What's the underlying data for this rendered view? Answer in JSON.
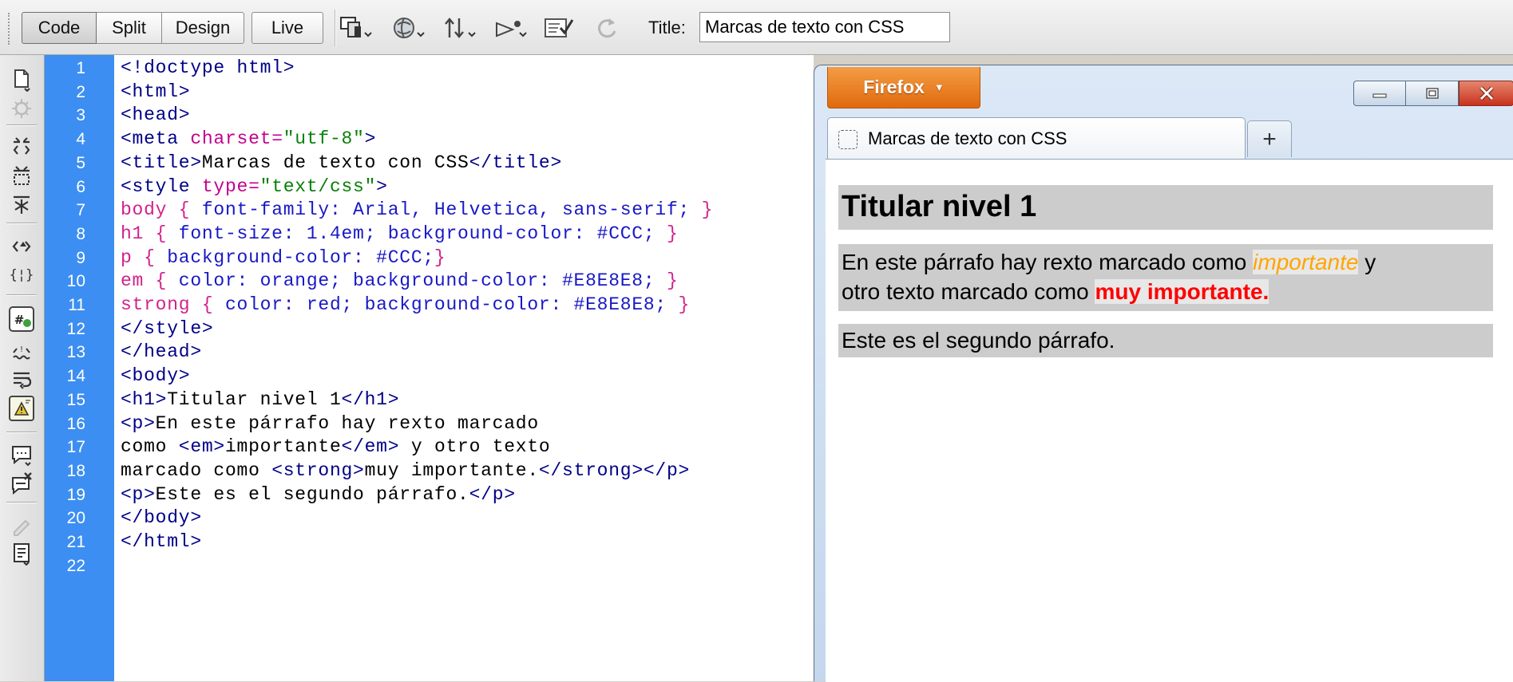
{
  "toolbar": {
    "views": [
      "Code",
      "Split",
      "Design",
      "Live"
    ],
    "active_view": "Code",
    "title_label": "Title:",
    "title_value": "Marcas de texto con CSS",
    "tools": [
      "multiscreen-icon",
      "preview-globe-icon",
      "file-transfer-icon",
      "visual-aids-icon",
      "validate-icon",
      "refresh-icon"
    ]
  },
  "rail": {
    "icons": [
      "open-documents-icon",
      "show-code-navigator-icon",
      "collapse-full-tag-icon",
      "collapse-selection-icon",
      "expand-all-icon",
      "select-parent-tag-icon",
      "balance-braces-icon",
      "line-numbers-icon",
      "highlight-invalid-code-icon",
      "word-wrap-icon",
      "syntax-error-alerts-icon",
      "apply-comment-icon",
      "remove-comment-icon",
      "wrap-tag-icon",
      "recent-snippets-icon"
    ]
  },
  "editor": {
    "line_numbers": [
      "1",
      "2",
      "3",
      "4",
      "5",
      "6",
      "7",
      "8",
      "9",
      "10",
      "11",
      "12",
      "13",
      "14",
      "15",
      "16",
      "17",
      "18",
      "19",
      "20",
      "21",
      "22"
    ],
    "lines": [
      [
        [
          "tg",
          "<!doctype html>"
        ]
      ],
      [
        [
          "tg",
          "<html>"
        ]
      ],
      [
        [
          "tg",
          "<head>"
        ]
      ],
      [
        [
          "tg",
          "<meta "
        ],
        [
          "at",
          "charset="
        ],
        [
          "st",
          "\"utf-8\""
        ],
        [
          "tg",
          ">"
        ]
      ],
      [
        [
          "tg",
          "<title>"
        ],
        [
          "tx",
          "Marcas de texto con CSS"
        ],
        [
          "tg",
          "</title>"
        ]
      ],
      [
        [
          "tg",
          "<style "
        ],
        [
          "at",
          "type="
        ],
        [
          "st",
          "\"text/css\""
        ],
        [
          "tg",
          ">"
        ]
      ],
      [
        [
          "cs",
          "body { "
        ],
        [
          "cv",
          "font-family: Arial, Helvetica, sans-serif;"
        ],
        [
          "cp",
          " }"
        ]
      ],
      [
        [
          "cs",
          "h1 { "
        ],
        [
          "cv",
          "font-size: 1.4em; background-color: #CCC;"
        ],
        [
          "cp",
          " }"
        ]
      ],
      [
        [
          "cs",
          "p { "
        ],
        [
          "cv",
          "background-color: #CCC;"
        ],
        [
          "cp",
          "}"
        ]
      ],
      [
        [
          "cs",
          "em { "
        ],
        [
          "cv",
          "color: orange; background-color: #E8E8E8;"
        ],
        [
          "cp",
          " }"
        ]
      ],
      [
        [
          "cs",
          "strong { "
        ],
        [
          "cv",
          "color: red; background-color: #E8E8E8;"
        ],
        [
          "cp",
          " }"
        ]
      ],
      [
        [
          "tg",
          "</style>"
        ]
      ],
      [
        [
          "tg",
          "</head>"
        ]
      ],
      [
        [
          "tg",
          "<body>"
        ]
      ],
      [
        [
          "tg",
          "<h1>"
        ],
        [
          "tx",
          "Titular nivel 1"
        ],
        [
          "tg",
          "</h1>"
        ]
      ],
      [
        [
          "tg",
          "<p>"
        ],
        [
          "tx",
          "En este párrafo hay rexto marcado"
        ]
      ],
      [
        [
          "tx",
          "como "
        ],
        [
          "tg",
          "<em>"
        ],
        [
          "tx",
          "importante"
        ],
        [
          "tg",
          "</em>"
        ],
        [
          "tx",
          " y otro texto"
        ]
      ],
      [
        [
          "tx",
          "marcado como "
        ],
        [
          "tg",
          "<strong>"
        ],
        [
          "tx",
          "muy importante."
        ],
        [
          "tg",
          "</strong></p>"
        ]
      ],
      [
        [
          "tg",
          "<p>"
        ],
        [
          "tx",
          "Este es el segundo párrafo."
        ],
        [
          "tg",
          "</p>"
        ]
      ],
      [
        [
          "tg",
          "</body>"
        ]
      ],
      [
        [
          "tg",
          "</html>"
        ]
      ],
      []
    ]
  },
  "browser": {
    "menu_button": "Firefox",
    "menu_arrow": "▼",
    "tab_title": "Marcas de texto con CSS",
    "new_tab": "+",
    "page": {
      "h1": "Titular nivel 1",
      "p1_part1": "En este párrafo hay rexto marcado como ",
      "p1_em": "importante",
      "p1_part2": " y",
      "p1_part3": "otro texto marcado como ",
      "p1_strong": "muy importante.",
      "p2": "Este es el segundo párrafo."
    }
  }
}
